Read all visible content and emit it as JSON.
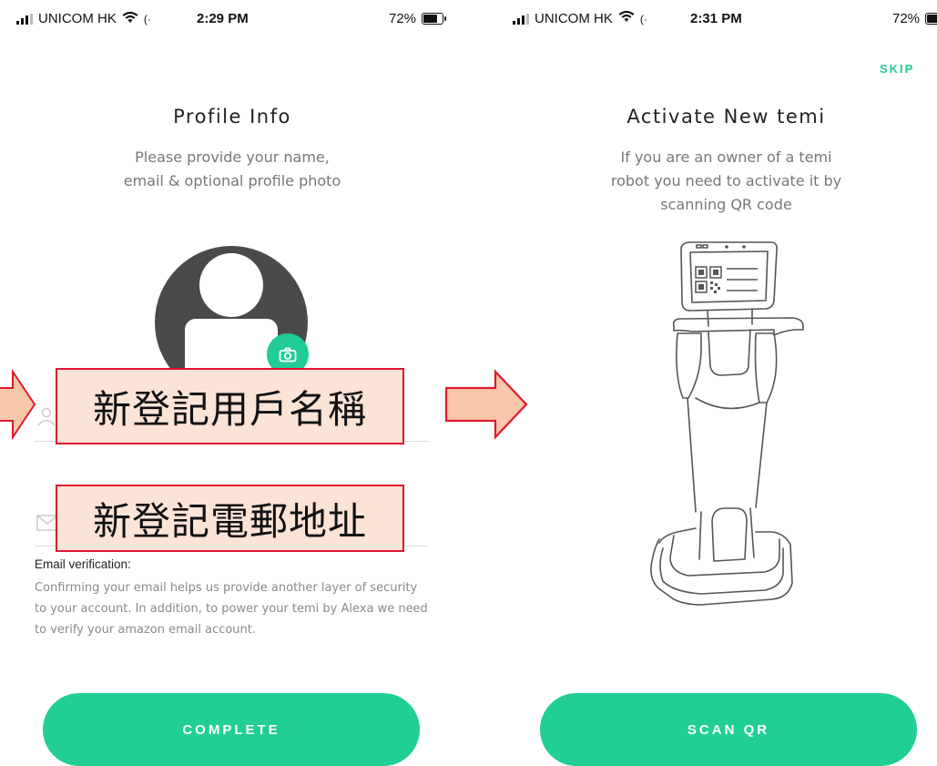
{
  "left_screen": {
    "status": {
      "carrier": "UNICOM HK",
      "time": "2:29 PM",
      "battery": "72%",
      "battery_level": 0.72
    },
    "title": "Profile Info",
    "subtitle": "Please provide your name,\nemail & optional profile photo",
    "name_callout": "新登記用戶名稱",
    "email_callout": "新登記電郵地址",
    "email_note_title": "Email verification:",
    "email_note_body": "Confirming your email helps us provide another layer of security to your account. In addition, to power your temi by Alexa we need to verify your amazon email account.",
    "complete_label": "COMPLETE",
    "icons": {
      "avatar": "user-avatar-icon",
      "camera": "camera-icon",
      "name": "person-icon",
      "email": "mail-icon"
    }
  },
  "right_screen": {
    "status": {
      "carrier": "UNICOM HK",
      "time": "2:31 PM",
      "battery": "72%",
      "battery_level": 0.72
    },
    "skip_label": "SKIP",
    "title": "Activate New temi",
    "subtitle": "If you are an owner of a temi\nrobot you need to activate it by\nscanning QR code",
    "scan_label": "SCAN QR",
    "icons": {
      "robot": "temi-robot-illustration",
      "qr": "qr-code-icon"
    }
  },
  "colors": {
    "accent": "#21cf96",
    "callout_fill": "#fbe3d6",
    "callout_border": "#e0182e",
    "arrow_fill": "#f8c6a8"
  }
}
